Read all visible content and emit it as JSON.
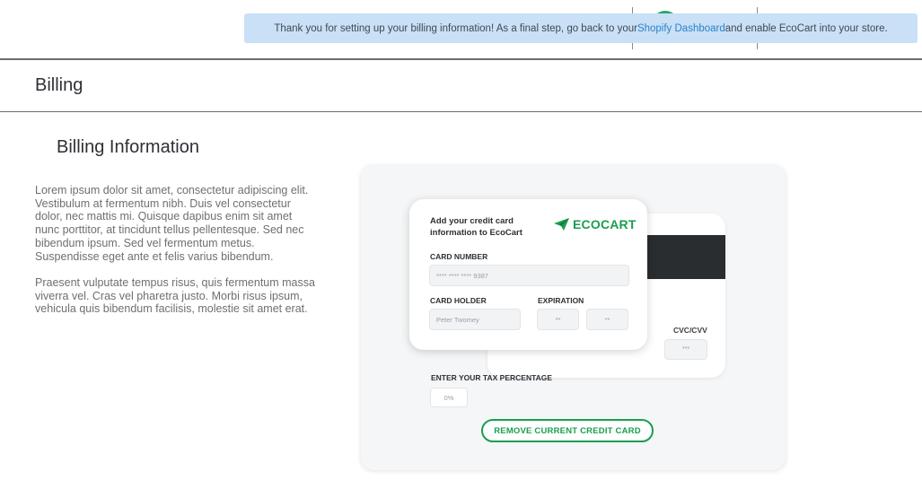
{
  "notice": {
    "text_before": "Thank you for setting up your billing information! As a final step, go back to your ",
    "link": "Shopify Dashboard",
    "text_after": " and enable EcoCart into your store."
  },
  "header": {
    "title": "Billing"
  },
  "section": {
    "title": "Billing Information",
    "paragraphs": [
      "Lorem ipsum dolor sit amet, consectetur adipiscing elit. Vestibulum at fermentum nibh. Duis vel consectetur dolor, nec mattis mi. Quisque dapibus enim sit amet nunc porttitor, at tincidunt tellus pellentesque. Sed nec bibendum ipsum. Sed vel fermentum metus. Suspendisse eget ante et felis varius bibendum.",
      "Praesent vulputate tempus risus, quis fermentum massa viverra vel. Cras vel pharetra justo. Morbi risus ipsum, vehicula quis bibendum facilisis, molestie sit amet erat."
    ]
  },
  "card": {
    "title": "Add your credit card information to EcoCart",
    "logo_text": "ECOCART",
    "logo_icon": "paper-plane-icon",
    "card_number_label": "CARD NUMBER",
    "card_number_placeholder": "**** **** **** 9387",
    "card_holder_label": "CARD HOLDER",
    "card_holder_placeholder": "Peter Twomey",
    "expiration_label": "EXPIRATION",
    "exp_month_placeholder": "**",
    "exp_year_placeholder": "**",
    "cvc_label": "CVC/CVV",
    "cvc_placeholder": "***"
  },
  "tax": {
    "label": "ENTER YOUR TAX PERCENTAGE",
    "placeholder": "0%"
  },
  "remove_button": "REMOVE CURRENT CREDIT CARD",
  "colors": {
    "accent_green": "#1a9e4e",
    "notice_bg": "#c9e0f6",
    "link_blue": "#2b82c9"
  }
}
